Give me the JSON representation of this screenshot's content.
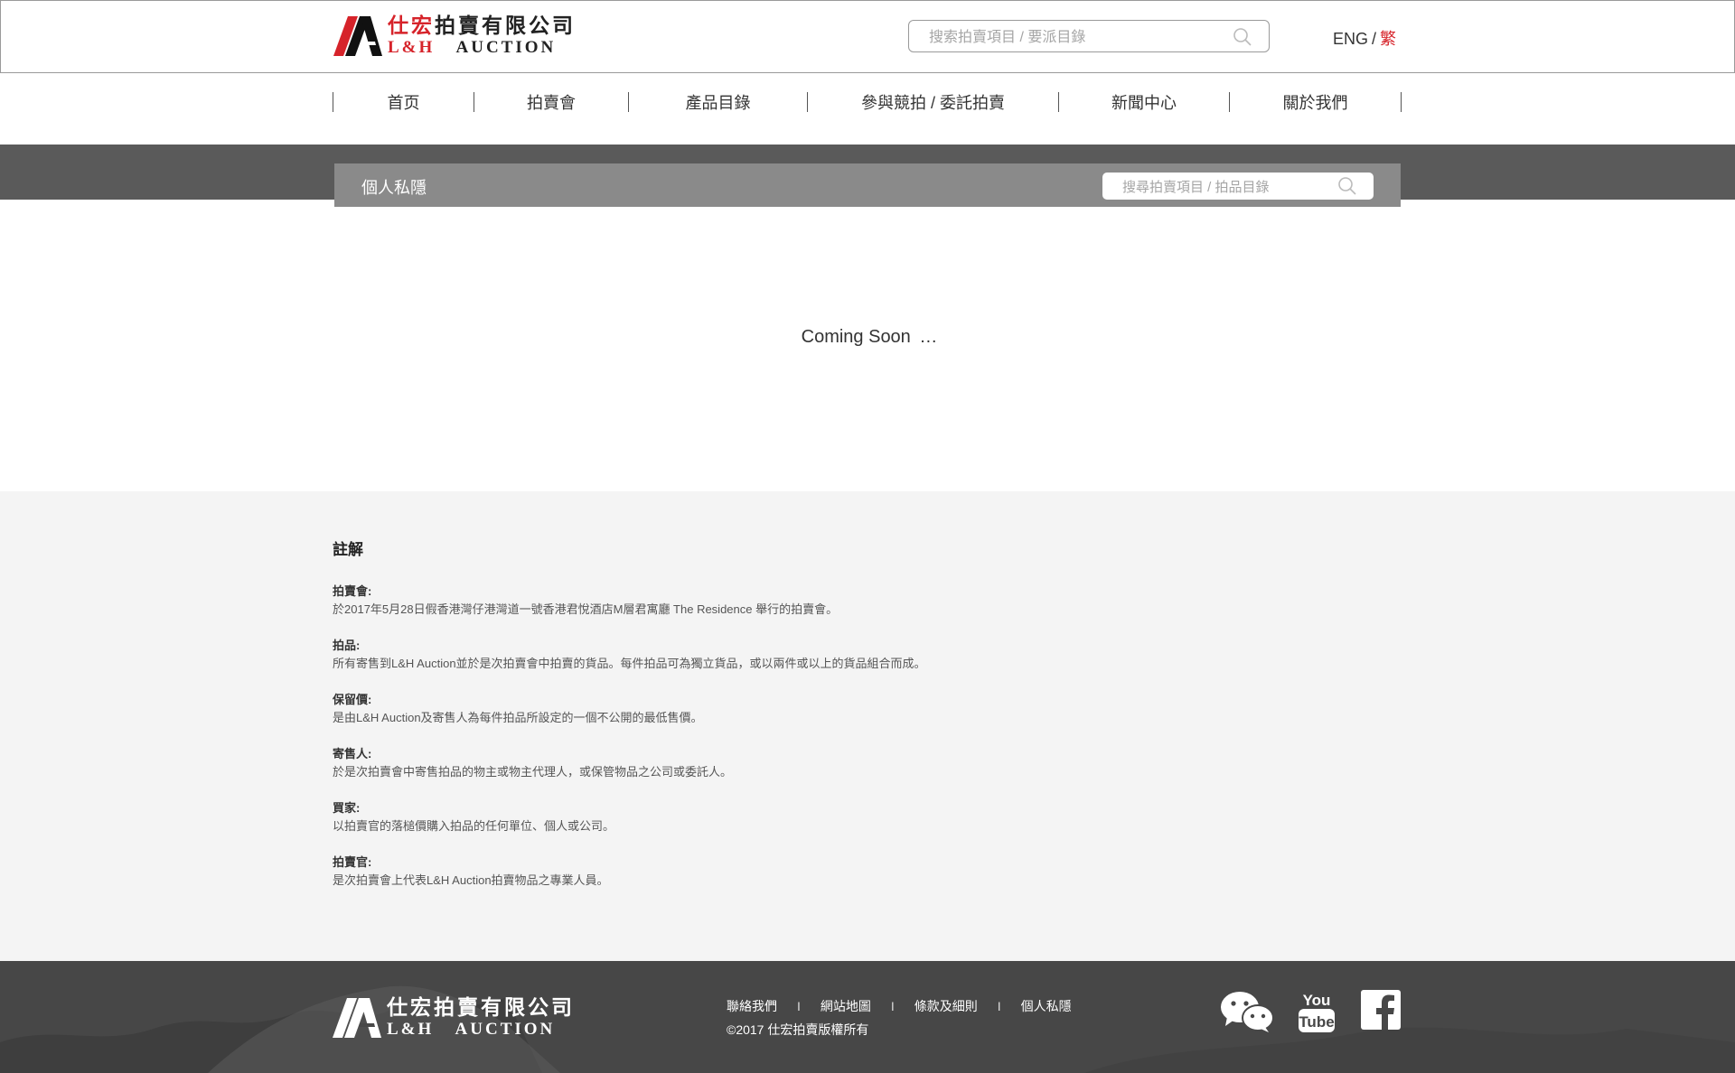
{
  "header": {
    "logo_cn_red": "仕宏",
    "logo_cn_rest": "拍賣有限公司",
    "logo_en_red": "L&H",
    "logo_en_rest": "AUCTION",
    "search_placeholder": "搜索拍賣項目 / 要派目錄",
    "lang_eng": "ENG",
    "lang_sep": "/",
    "lang_tc": "繁"
  },
  "nav": {
    "items": [
      {
        "label": "首页"
      },
      {
        "label": "拍賣會"
      },
      {
        "label": "產品目錄"
      },
      {
        "label": "參與競拍 / 委託拍賣"
      },
      {
        "label": "新聞中心"
      },
      {
        "label": "關於我們"
      }
    ]
  },
  "subbar": {
    "title": "個人私隱",
    "search_placeholder": "搜尋拍賣項目 / 拍品目錄"
  },
  "main": {
    "coming_soon": "Coming Soon",
    "ellipsis": "…"
  },
  "notes": {
    "title": "註解",
    "items": [
      {
        "term": "拍賣會:",
        "definition": "於2017年5月28日假香港灣仔港灣道一號香港君悅酒店M層君寓廳 The Residence 舉行的拍賣會。"
      },
      {
        "term": "拍品:",
        "definition": "所有寄售到L&H Auction並於是次拍賣會中拍賣的貨品。每件拍品可為獨立貨品，或以兩件或以上的貨品組合而成。"
      },
      {
        "term": "保留價:",
        "definition": "是由L&H Auction及寄售人為每件拍品所設定的一個不公開的最低售價。"
      },
      {
        "term": "寄售人:",
        "definition": "於是次拍賣會中寄售拍品的物主或物主代理人，或保管物品之公司或委託人。"
      },
      {
        "term": "買家:",
        "definition": "以拍賣官的落槌價購入拍品的任何單位、個人或公司。"
      },
      {
        "term": "拍賣官:",
        "definition": "是次拍賣會上代表L&H Auction拍賣物品之專業人員。"
      }
    ]
  },
  "footer": {
    "logo_cn": "仕宏拍賣有限公司",
    "logo_en_1": "L&H",
    "logo_en_2": "AUCTION",
    "links": [
      {
        "label": "聯絡我們"
      },
      {
        "label": "網站地圖"
      },
      {
        "label": "條款及細則"
      },
      {
        "label": "個人私隱"
      }
    ],
    "link_sep": "I",
    "copyright": "©2017 仕宏拍賣版權所有",
    "youtube_you": "You",
    "youtube_tube": "Tube"
  },
  "colors": {
    "accent_red": "#d6232a",
    "band_gray": "#5a5a5a",
    "subbar_gray": "#8a8a8a",
    "notes_bg": "#f4f4f4",
    "footer_bg": "#474747"
  },
  "icons": [
    "logo-mark",
    "search-icon",
    "wechat-icon",
    "youtube-icon",
    "facebook-icon"
  ]
}
